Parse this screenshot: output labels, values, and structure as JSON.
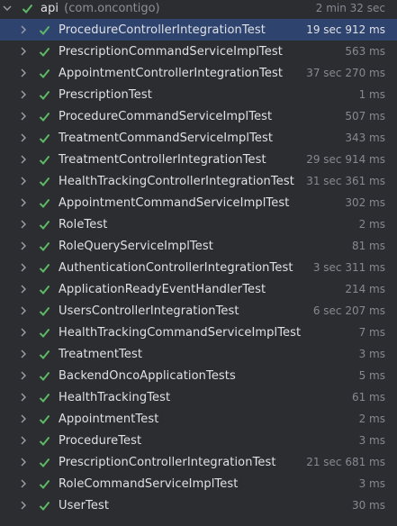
{
  "root": {
    "label": "api",
    "package": "(com.oncontigo)",
    "time": "2 min 32 sec",
    "status": "passed"
  },
  "tests": [
    {
      "label": "ProcedureControllerIntegrationTest",
      "time": "19 sec 912 ms",
      "selected": true
    },
    {
      "label": "PrescriptionCommandServiceImplTest",
      "time": "563 ms"
    },
    {
      "label": "AppointmentControllerIntegrationTest",
      "time": "37 sec 270 ms"
    },
    {
      "label": "PrescriptionTest",
      "time": "1 ms"
    },
    {
      "label": "ProcedureCommandServiceImplTest",
      "time": "507 ms"
    },
    {
      "label": "TreatmentCommandServiceImplTest",
      "time": "343 ms"
    },
    {
      "label": "TreatmentControllerIntegrationTest",
      "time": "29 sec 914 ms"
    },
    {
      "label": "HealthTrackingControllerIntegrationTest",
      "time": "31 sec 361 ms"
    },
    {
      "label": "AppointmentCommandServiceImplTest",
      "time": "302 ms"
    },
    {
      "label": "RoleTest",
      "time": "2 ms"
    },
    {
      "label": "RoleQueryServiceImplTest",
      "time": "81 ms"
    },
    {
      "label": "AuthenticationControllerIntegrationTest",
      "time": "3 sec 311 ms"
    },
    {
      "label": "ApplicationReadyEventHandlerTest",
      "time": "214 ms"
    },
    {
      "label": "UsersControllerIntegrationTest",
      "time": "6 sec 207 ms"
    },
    {
      "label": "HealthTrackingCommandServiceImplTest",
      "time": "7 ms"
    },
    {
      "label": "TreatmentTest",
      "time": "3 ms"
    },
    {
      "label": "BackendOncoApplicationTests",
      "time": "5 ms"
    },
    {
      "label": "HealthTrackingTest",
      "time": "61 ms"
    },
    {
      "label": "AppointmentTest",
      "time": "2 ms"
    },
    {
      "label": "ProcedureTest",
      "time": "3 ms"
    },
    {
      "label": "PrescriptionControllerIntegrationTest",
      "time": "21 sec 681 ms"
    },
    {
      "label": "RoleCommandServiceImplTest",
      "time": "3 ms"
    },
    {
      "label": "UserTest",
      "time": "30 ms"
    }
  ],
  "icons": {
    "expand_open": "chevron-down-icon",
    "expand_closed": "chevron-right-icon",
    "status": "check-icon"
  },
  "colors": {
    "passed": "#5fb865",
    "selection": "#2e436e",
    "background": "#2b2d30"
  }
}
